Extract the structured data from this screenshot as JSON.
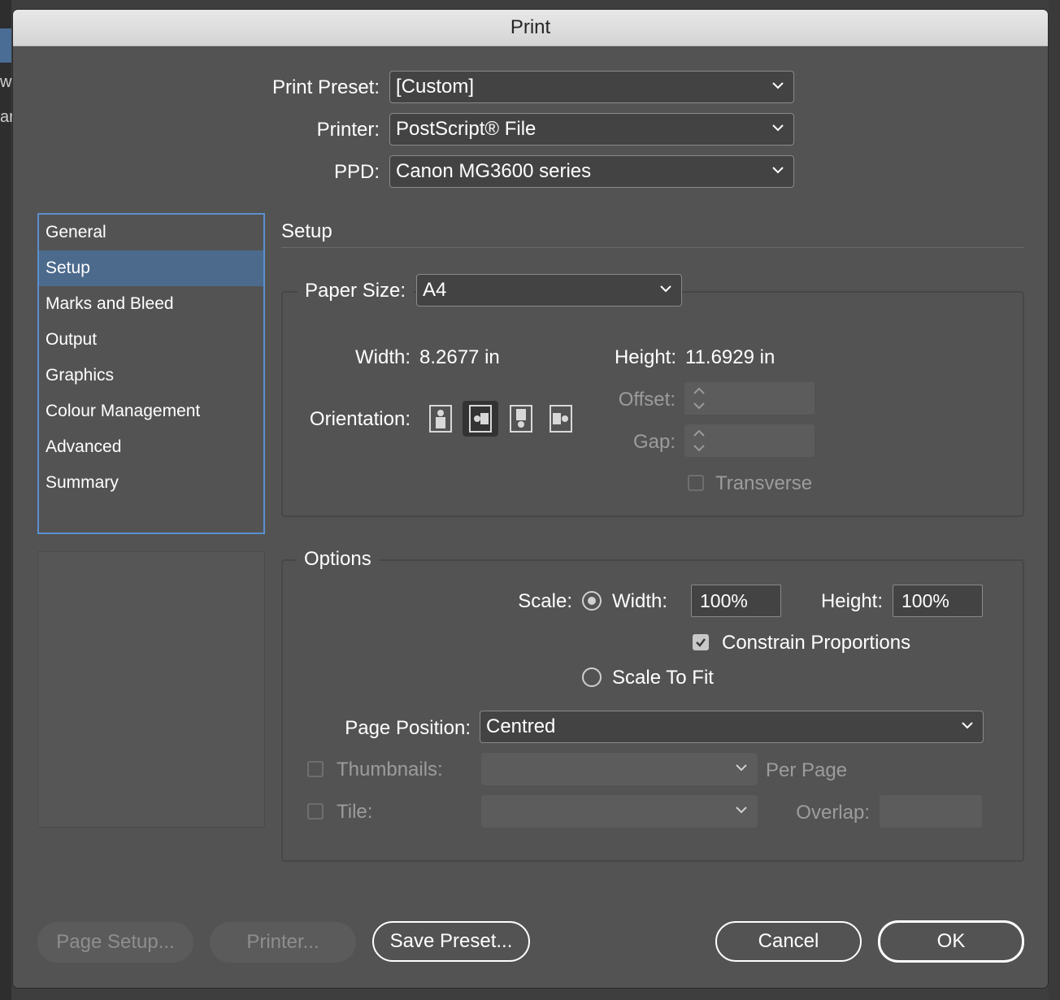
{
  "background": {
    "text_1": "w",
    "text_2": "ar"
  },
  "dialog": {
    "title": "Print",
    "print_preset": {
      "label": "Print Preset:",
      "value": "[Custom]"
    },
    "printer": {
      "label": "Printer:",
      "value": "PostScript® File"
    },
    "ppd": {
      "label": "PPD:",
      "value": "Canon MG3600 series"
    },
    "sidebar": {
      "items": [
        {
          "label": "General"
        },
        {
          "label": "Setup"
        },
        {
          "label": "Marks and Bleed"
        },
        {
          "label": "Output"
        },
        {
          "label": "Graphics"
        },
        {
          "label": "Colour Management"
        },
        {
          "label": "Advanced"
        },
        {
          "label": "Summary"
        }
      ],
      "selected": "Setup"
    },
    "setup": {
      "title": "Setup",
      "paper_size": {
        "label": "Paper Size:",
        "value": "A4"
      },
      "width": {
        "label": "Width:",
        "value": "8.2677 in"
      },
      "height": {
        "label": "Height:",
        "value": "11.6929 in"
      },
      "orientation": {
        "label": "Orientation:",
        "selected_index": 1
      },
      "offset": {
        "label": "Offset:"
      },
      "gap": {
        "label": "Gap:"
      },
      "transverse": {
        "label": "Transverse",
        "checked": false
      }
    },
    "options": {
      "title": "Options",
      "scale": {
        "label": "Scale:",
        "width_label": "Width:",
        "width_value": "100%",
        "height_label": "Height:",
        "height_value": "100%",
        "constrain_label": "Constrain Proportions",
        "scale_to_fit_label": "Scale To Fit"
      },
      "page_position": {
        "label": "Page Position:",
        "value": "Centred"
      },
      "thumbnails": {
        "label": "Thumbnails:",
        "per_page_label": "Per Page"
      },
      "tile": {
        "label": "Tile:",
        "overlap_label": "Overlap:"
      }
    },
    "buttons": {
      "page_setup": "Page Setup...",
      "printer": "Printer...",
      "save_preset": "Save Preset...",
      "cancel": "Cancel",
      "ok": "OK"
    }
  }
}
